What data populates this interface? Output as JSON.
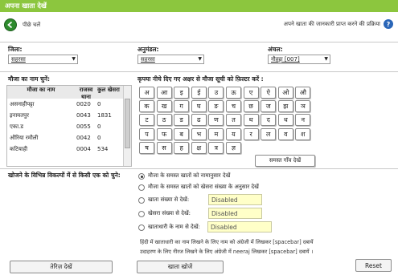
{
  "header": {
    "title": "अपना खाता देखें"
  },
  "nav": {
    "back_label": "पीछे चलें",
    "info_link": "अपने खाता की जानकारी प्राप्त करने की प्रक्रिया",
    "help_glyph": "?"
  },
  "filters": {
    "district_label": "जिला:",
    "district_value": "सहरसा",
    "subdivision_label": "अनुमंडल:",
    "subdivision_value": "सहरसा",
    "circle_label": "अंचल:",
    "circle_value": "नौहट्टा [007]"
  },
  "village": {
    "label": "मौजा का नाम चुनें:",
    "columns": [
      "मौजा का नाम",
      "राजस्व थाना",
      "कुल खेसरा"
    ],
    "rows": [
      [
        "असनाहीपट्टा",
        "0020",
        "0"
      ],
      [
        "इनायतपुर",
        "0043",
        "1831"
      ],
      [
        "एका.ड",
        "0055",
        "0"
      ],
      [
        "औरिया रमौली",
        "0042",
        "0"
      ],
      [
        "कटियाही",
        "0004",
        "534"
      ]
    ]
  },
  "keyboard": {
    "label": "कृपया नीचे दिए गए अक्षर से मौजा सूची को फ़िल्टर करें :",
    "rows": [
      [
        "अ",
        "आ",
        "इ",
        "ई",
        "उ",
        "ऊ",
        "ए",
        "ऐ",
        "ओ",
        "औ"
      ],
      [
        "क",
        "ख",
        "ग",
        "घ",
        "ङ",
        "च",
        "छ",
        "ज",
        "झ",
        "ञ"
      ],
      [
        "ट",
        "ठ",
        "ड",
        "ढ",
        "ण",
        "त",
        "थ",
        "द",
        "ध",
        "न"
      ],
      [
        "प",
        "फ",
        "ब",
        "भ",
        "म",
        "य",
        "र",
        "ल",
        "व",
        "श"
      ],
      [
        "ष",
        "स",
        "ह",
        "क्ष",
        "त्र",
        "ज्ञ"
      ]
    ],
    "all_villages_button": "समस्त गाँव देखें"
  },
  "search_options": {
    "label": "खोजने के विभिन्न विकल्पों में से किसी एक को चुने:",
    "options": [
      {
        "label": "मौजा के समस्त खातों को नामानुसार देखें",
        "selected": true
      },
      {
        "label": "मौजा के समस्त खातों को खेसरा संख्या के अनुसार देखें",
        "selected": false
      },
      {
        "label": "खाता संख्या से देखें:",
        "selected": false,
        "input": "Disabled"
      },
      {
        "label": "खेसरा संख्या से देखें:",
        "selected": false,
        "input": "Disabled"
      },
      {
        "label": "खाताधारी के नाम से देखें:",
        "selected": false,
        "input": "Disabled"
      }
    ],
    "hint1": "हिंदी में खाताधारी का नाम लिखने के लिए नाम को अंग्रेजी में लिखकर [spacebar] दबायें",
    "hint2": "उदाहरण के लिए नीरज लिखने के लिए अंग्रेजी में neeraj लिखकर [spacebar] दबायें ।"
  },
  "actions": {
    "register_button": "तेरिज़ देखें",
    "search_button": "खाता खोजें",
    "reset_button": "Reset"
  }
}
